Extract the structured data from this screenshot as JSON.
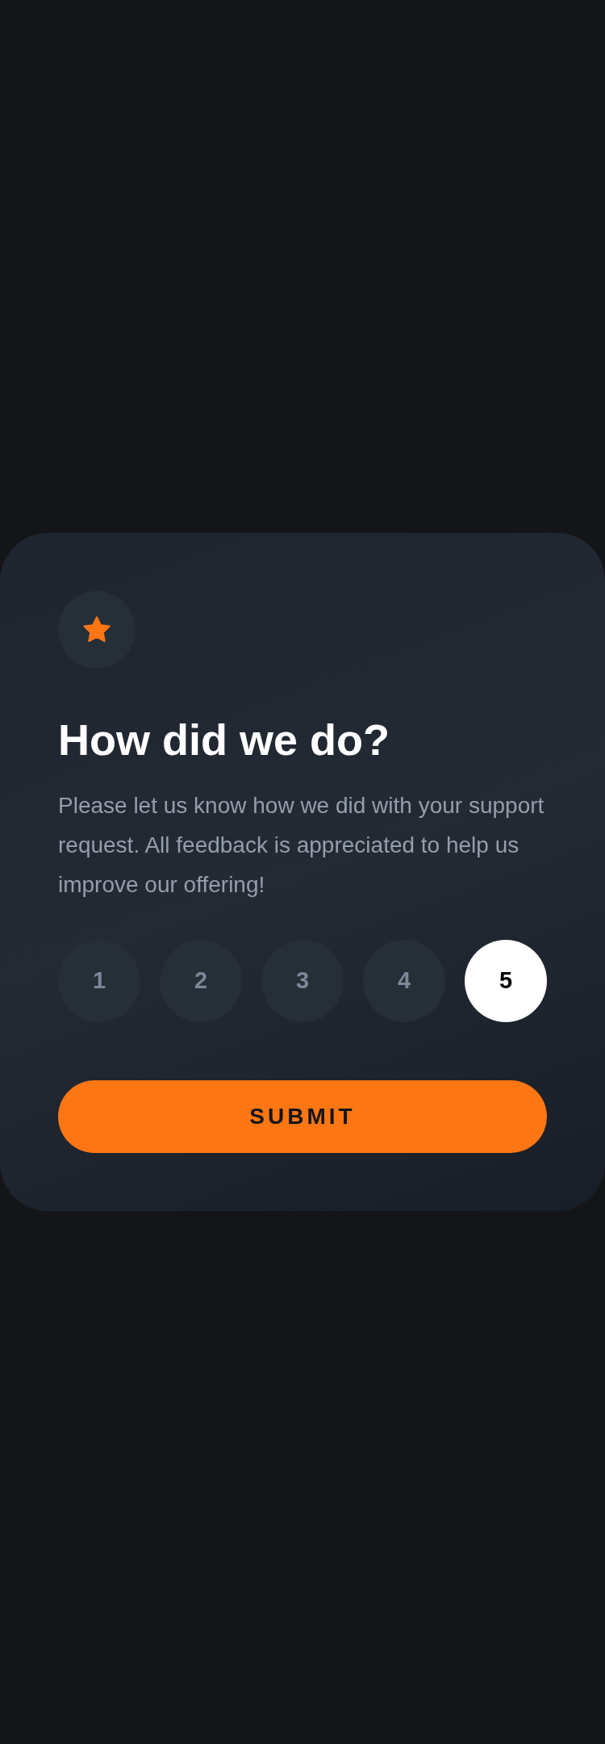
{
  "card": {
    "title": "How did we do?",
    "description": "Please let us know how we did with your support request. All feedback is appreciated to help us improve our offering!",
    "ratings": [
      {
        "label": "1",
        "selected": false
      },
      {
        "label": "2",
        "selected": false
      },
      {
        "label": "3",
        "selected": false
      },
      {
        "label": "4",
        "selected": false
      },
      {
        "label": "5",
        "selected": true
      }
    ],
    "submit": "SUBMIT"
  }
}
